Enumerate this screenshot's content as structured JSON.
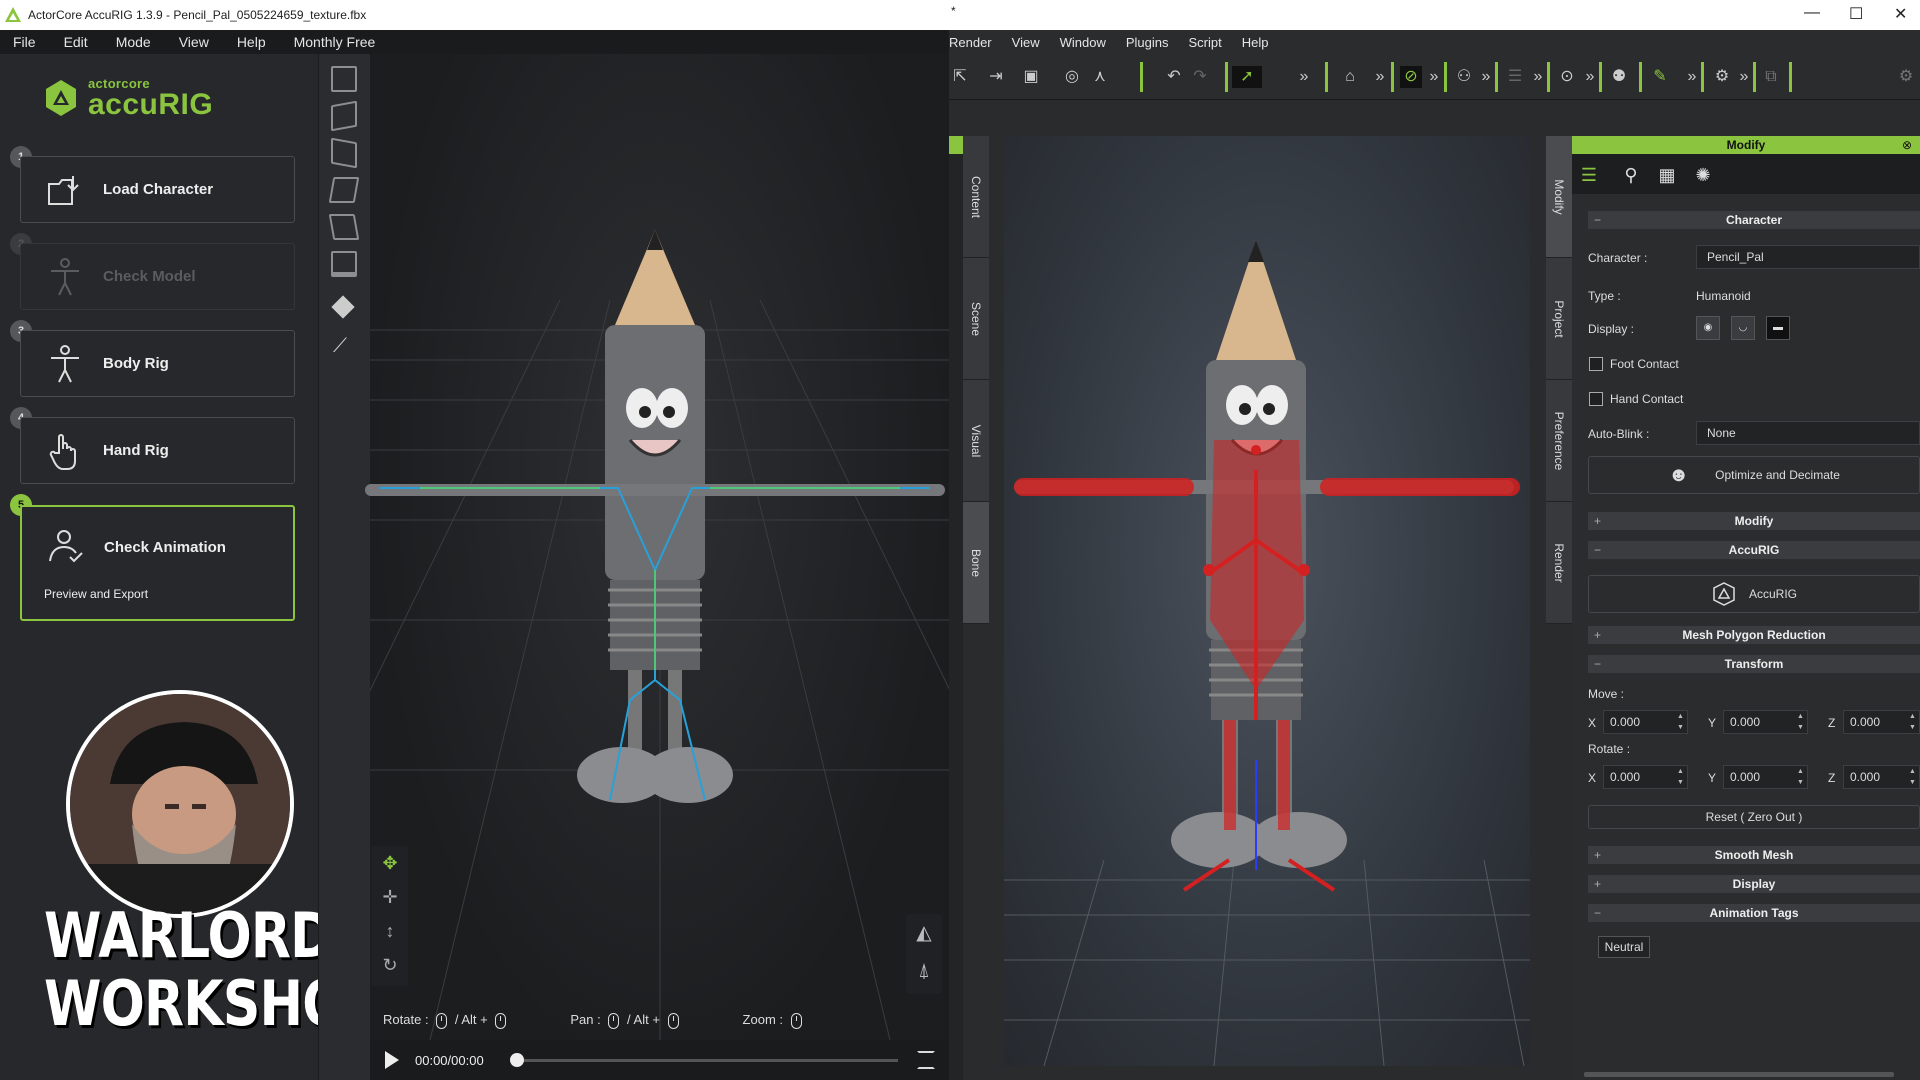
{
  "left_app": {
    "title": "ActorCore AccuRIG 1.3.9 - Pencil_Pal_0505224659_texture.fbx",
    "menu": [
      "File",
      "Edit",
      "Mode",
      "View",
      "Help",
      "Monthly Free"
    ],
    "brand": {
      "small": "actorcore",
      "big": "accuRIG"
    },
    "steps": [
      {
        "num": "1",
        "label": "Load Character",
        "icon": "load-character-icon",
        "state": "normal"
      },
      {
        "num": "2",
        "label": "Check Model",
        "icon": "check-model-icon",
        "state": "disabled"
      },
      {
        "num": "3",
        "label": "Body Rig",
        "icon": "body-rig-icon",
        "state": "normal"
      },
      {
        "num": "4",
        "label": "Hand Rig",
        "icon": "hand-rig-icon",
        "state": "normal"
      },
      {
        "num": "5",
        "label": "Check Animation",
        "sub": "Preview and Export",
        "icon": "check-animation-icon",
        "state": "active"
      }
    ],
    "overlay_text_line1": "WARLORD’S",
    "overlay_text_line2": "WORKSHOP",
    "hint": {
      "rotate": "Rotate",
      "pan": "Pan",
      "zoom": "Zoom",
      "alt": "Alt",
      "sep": "/",
      "plus": "+",
      "colon": ":"
    },
    "time": "00:00/00:00"
  },
  "right_app": {
    "title_fragment": "*",
    "menu": [
      "Render",
      "View",
      "Window",
      "Plugins",
      "Script",
      "Help"
    ],
    "left_tabs": [
      "Content",
      "Scene",
      "Visual",
      "Bone"
    ],
    "right_tabs": [
      "Modify",
      "Project",
      "Preference",
      "Render"
    ],
    "panel": {
      "header": "Modify",
      "sections": {
        "character": "Character",
        "modify": "Modify",
        "accurig": "AccuRIG",
        "mesh": "Mesh Polygon Reduction",
        "transform": "Transform",
        "smooth": "Smooth Mesh",
        "display": "Display",
        "tags": "Animation Tags"
      },
      "character_label": "Character :",
      "character_value": "Pencil_Pal",
      "type_label": "Type :",
      "type_value": "Humanoid",
      "display_label": "Display :",
      "foot_contact": "Foot Contact",
      "hand_contact": "Hand Contact",
      "autoblink_label": "Auto-Blink :",
      "autoblink_value": "None",
      "optimize_btn": "Optimize and Decimate",
      "accurig_btn": "AccuRIG",
      "move_label": "Move :",
      "rotate_label": "Rotate :",
      "axis": {
        "x": "X",
        "y": "Y",
        "z": "Z"
      },
      "move": {
        "x": "0.000",
        "y": "0.000",
        "z": "0.000"
      },
      "rotate": {
        "x": "0.000",
        "y": "0.000",
        "z": "0.000"
      },
      "reset_btn": "Reset ( Zero Out )",
      "tag": "Neutral"
    }
  },
  "colors": {
    "accent": "#8bc53f",
    "rig_red": "#d42020"
  }
}
